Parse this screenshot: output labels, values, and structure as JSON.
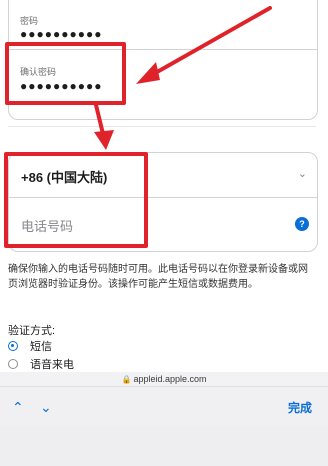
{
  "password": {
    "label": "密码",
    "value": "●●●●●●●●●●"
  },
  "confirm_password": {
    "label": "确认密码",
    "value": "●●●●●●●●●●"
  },
  "country": {
    "value": "+86 (中国大陆)"
  },
  "phone": {
    "placeholder": "电话号码"
  },
  "info_text": "确保你输入的电话号码随时可用。此电话号码以在你登录新设备或网页浏览器时验证身份。该操作可能产生短信或数据费用。",
  "verification": {
    "title": "验证方式:",
    "options": [
      {
        "label": "短信",
        "selected": true
      },
      {
        "label": "语音来电",
        "selected": false
      }
    ]
  },
  "address_bar": {
    "url": "appleid.apple.com"
  },
  "keyboard_toolbar": {
    "done_label": "完成"
  },
  "colors": {
    "highlight": "#e0232a",
    "accent": "#0a6fd6"
  },
  "icons": [
    "chevron-down-icon",
    "help-icon",
    "lock-icon",
    "arrow-up-icon",
    "arrow-down-icon"
  ]
}
